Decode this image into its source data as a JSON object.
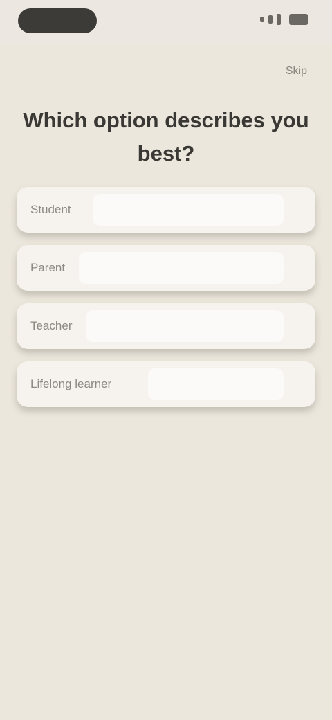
{
  "header": {
    "skip_label": "Skip"
  },
  "question": {
    "title": "Which option describes you best?"
  },
  "options": [
    {
      "label": "Student"
    },
    {
      "label": "Parent"
    },
    {
      "label": "Teacher"
    },
    {
      "label": "Lifelong learner"
    }
  ],
  "colors": {
    "background": "#ece7dc",
    "card": "#f6f3ee",
    "title": "#3a3835",
    "option_text": "#8d8983"
  }
}
